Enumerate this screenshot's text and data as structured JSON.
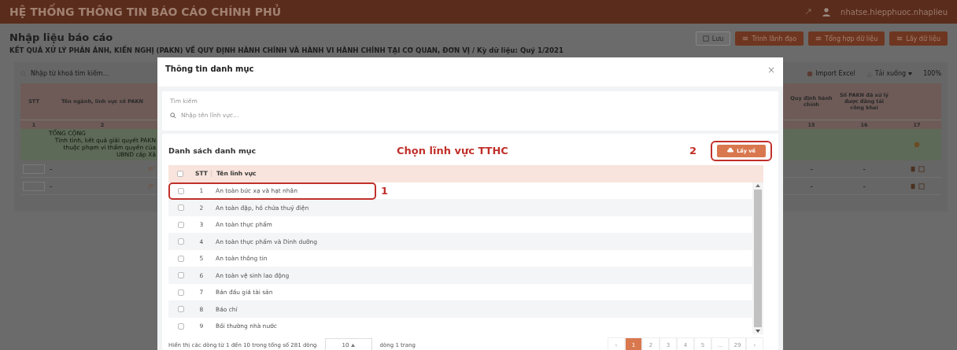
{
  "header": {
    "title": "HỆ THỐNG THÔNG TIN BÁO CÁO CHÍNH PHỦ",
    "user": "nhatse.hiepphuoc.nhaplieu"
  },
  "page": {
    "title": "Nhập liệu báo cáo",
    "subtitle": "KẾT QUẢ XỬ LÝ PHẢN ÁNH, KIẾN NGHỊ (PAKN) VỀ QUY ĐỊNH HÀNH CHÍNH VÀ HÀNH VI HÀNH CHÍNH TẠI CƠ QUAN, ĐƠN VỊ / Kỳ dữ liệu: Quý 1/2021",
    "actions": [
      {
        "label": "Lưu",
        "kind": "outline"
      },
      {
        "label": "Trình lãnh đạo",
        "kind": "filled"
      },
      {
        "label": "Tổng hợp dữ liệu",
        "kind": "filled"
      },
      {
        "label": "Lấy dữ liệu",
        "kind": "filled"
      }
    ]
  },
  "report": {
    "search_placeholder": "Nhập từ khoá tìm kiếm...",
    "import": "Import Excel",
    "download": "Tải xuống",
    "zoom": "100%",
    "columns": [
      "STT",
      "Tên ngành, lĩnh vực có PAKN",
      "Quy định hành chính",
      "Số PAKN đã xử lý được đăng tải công khai",
      ""
    ],
    "column_numbers": [
      "1",
      "2",
      "15",
      "16",
      "17"
    ],
    "total_row": {
      "label": "TỔNG CỘNG",
      "description": "Tính tỉnh, kết quả giải quyết PAKN thuộc phạm vi thẩm quyền của UBND cấp Xã"
    },
    "rows": [
      {
        "name": "-",
        "col15": "-",
        "col16": "-"
      },
      {
        "name": "-",
        "col15": "-",
        "col16": "-"
      }
    ]
  },
  "modal": {
    "title": "Thông tin danh mục",
    "close": "×",
    "search": {
      "label": "Tìm kiếm",
      "placeholder": "Nhập tên lĩnh vực..."
    },
    "list_title": "Danh sách danh mục",
    "hint": "Chọn lĩnh vực TTHC",
    "fetch_button": {
      "label": "Lấy về",
      "outlined": true,
      "callout": "2"
    },
    "header_checked": false,
    "columns": [
      "STT",
      "Tên lĩnh vực"
    ],
    "rows": [
      {
        "stt": "1",
        "name": "An toàn bức xạ và hạt nhân",
        "checked": false,
        "outlined": true,
        "callout": "1"
      },
      {
        "stt": "2",
        "name": "An toàn đập, hồ chứa thuỷ điện",
        "checked": false,
        "outlined": false
      },
      {
        "stt": "3",
        "name": "An toàn thực phẩm",
        "checked": false,
        "outlined": false
      },
      {
        "stt": "4",
        "name": "An toàn thực phẩm và Dinh dưỡng",
        "checked": false,
        "outlined": false
      },
      {
        "stt": "5",
        "name": "An toàn thông tin",
        "checked": false,
        "outlined": false
      },
      {
        "stt": "6",
        "name": "An toàn vệ sinh lao động",
        "checked": false,
        "outlined": false
      },
      {
        "stt": "7",
        "name": "Bán đấu giá tài sản",
        "checked": false,
        "outlined": false
      },
      {
        "stt": "8",
        "name": "Báo chí",
        "checked": false,
        "outlined": false
      },
      {
        "stt": "9",
        "name": "Bồi thường nhà nước",
        "checked": false,
        "outlined": false
      }
    ],
    "footer": {
      "summary": "Hiển thị các dòng từ 1 đến 10 trong tổng số 281 dòng",
      "page_size": "10",
      "suffix": "dòng 1 trang",
      "prev": "‹",
      "next": "›",
      "pages": [
        {
          "label": "1",
          "selected": true
        },
        {
          "label": "2",
          "selected": false
        },
        {
          "label": "3",
          "selected": false
        },
        {
          "label": "4",
          "selected": false
        },
        {
          "label": "5",
          "selected": false
        },
        {
          "label": "...",
          "selected": false
        },
        {
          "label": "29",
          "selected": false
        }
      ]
    }
  }
}
